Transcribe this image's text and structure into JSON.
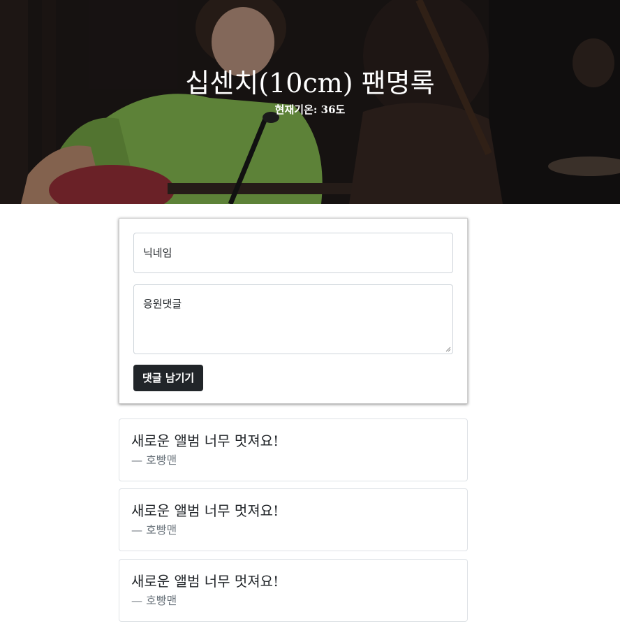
{
  "header": {
    "title": "십센치(10cm) 팬명록",
    "subtitle": "현재기온: 36도"
  },
  "form": {
    "nickname_placeholder": "닉네임",
    "comment_placeholder": "응원댓글",
    "submit_label": "댓글 남기기"
  },
  "comments": [
    {
      "text": "새로운 앨범 너무 멋져요!",
      "author": "— 호빵맨"
    },
    {
      "text": "새로운 앨범 너무 멋져요!",
      "author": "— 호빵맨"
    },
    {
      "text": "새로운 앨범 너무 멋져요!",
      "author": "— 호빵맨"
    }
  ],
  "colors": {
    "button_bg": "#212529",
    "author_text": "#6c757d",
    "shirt": "#8fc856"
  }
}
